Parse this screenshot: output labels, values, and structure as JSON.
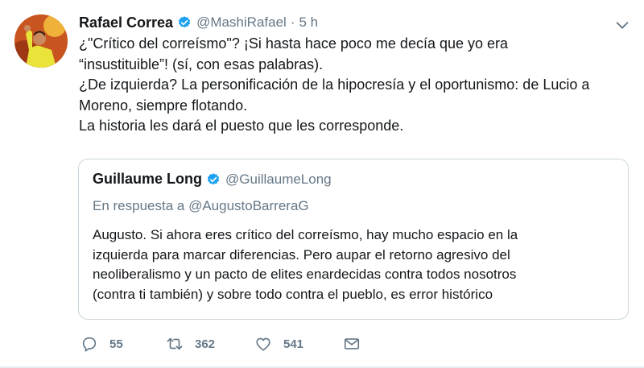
{
  "tweet": {
    "author_name": "Rafael Correa",
    "author_handle": "@MashiRafael",
    "separator": "·",
    "time": "5 h",
    "lines": [
      "¿\"Crítico del correísmo\"? ¡Si hasta hace poco me decía que yo era",
      "“insustituible”! (sí, con esas palabras).",
      "¿De izquierda? La personificación de la hipocresía y el oportunismo: de Lucio a",
      "Moreno, siempre flotando.",
      "La historia les dará el puesto que les corresponde."
    ],
    "verified_icon": "verified-badge-icon",
    "menu_icon": "chevron-down-icon"
  },
  "quote": {
    "author_name": "Guillaume Long",
    "author_handle": "@GuillaumeLong",
    "reply_prefix": "En respuesta a ",
    "reply_to": "@AugustoBarreraG",
    "lines": [
      "Augusto. Si ahora eres crítico del correísmo, hay mucho espacio en la",
      "izquierda para marcar diferencias. Pero aupar el retorno agresivo del",
      "neoliberalismo y un pacto de elites enardecidas contra todos nosotros",
      "(contra ti también) y sobre todo contra el pueblo, es error histórico"
    ]
  },
  "actions": {
    "replies": "55",
    "retweets": "362",
    "likes": "541",
    "icons": [
      "reply-icon",
      "retweet-icon",
      "like-icon",
      "direct-message-icon"
    ]
  },
  "colors": {
    "text": "#14171a",
    "secondary": "#657786",
    "border": "#ccd6dd",
    "verified": "#1da1f2"
  }
}
